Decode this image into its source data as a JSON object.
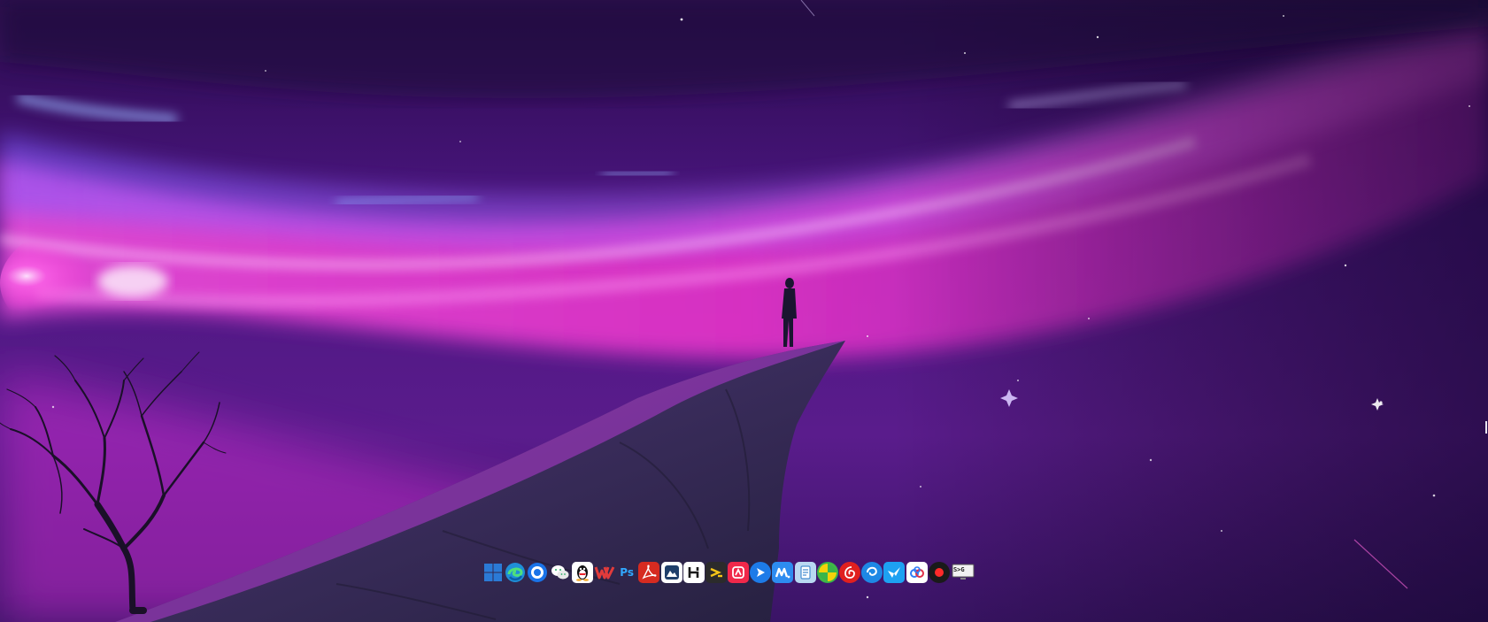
{
  "colors": {
    "sky_top": "#2a0a4a",
    "nebula_pink": "#ff3fd8",
    "nebula_blue": "#6a8cff",
    "cliff": "#3a2c58",
    "accent_white": "#ffffff"
  },
  "taskbar": {
    "items": [
      {
        "icon": "windows-start-icon",
        "bg": "#2b7ad6"
      },
      {
        "icon": "edge-browser-icon",
        "bg": "#1f8fd8"
      },
      {
        "icon": "circle-browser-icon",
        "bg": "#1a73e8"
      },
      {
        "icon": "wechat-icon",
        "bg": "#ffffff"
      },
      {
        "icon": "qq-penguin-icon",
        "bg": "#ffffff"
      },
      {
        "icon": "wps-office-icon",
        "bg": "#e23b3b"
      },
      {
        "icon": "photoshop-icon",
        "bg": "#0b2340",
        "text": "Ps"
      },
      {
        "icon": "acrobat-pdf-icon",
        "bg": "#d62b20"
      },
      {
        "icon": "mountain-app-icon",
        "bg": "#ffffff"
      },
      {
        "icon": "h-app-icon",
        "bg": "#ffffff"
      },
      {
        "icon": "arrow-app-icon",
        "bg": "#2b2b2b"
      },
      {
        "icon": "red-app-icon",
        "bg": "#f0284a"
      },
      {
        "icon": "blue-arrow-icon",
        "bg": "#1d7be8"
      },
      {
        "icon": "m-app-icon",
        "bg": "#2d8cf0"
      },
      {
        "icon": "document-app-icon",
        "bg": "#b9d8f2"
      },
      {
        "icon": "green-yellow-icon",
        "bg": "#39b54a"
      },
      {
        "icon": "netease-music-icon",
        "bg": "#e0201f"
      },
      {
        "icon": "blue-swirl-icon",
        "bg": "#1e88e5"
      },
      {
        "icon": "bird-app-icon",
        "bg": "#1da1f2"
      },
      {
        "icon": "cloud-drive-icon",
        "bg": "#ffffff"
      },
      {
        "icon": "record-icon",
        "bg": "#1a1a1a"
      },
      {
        "icon": "monitor-app-icon",
        "bg": "#2c2c2c",
        "text": "S>G"
      }
    ]
  }
}
